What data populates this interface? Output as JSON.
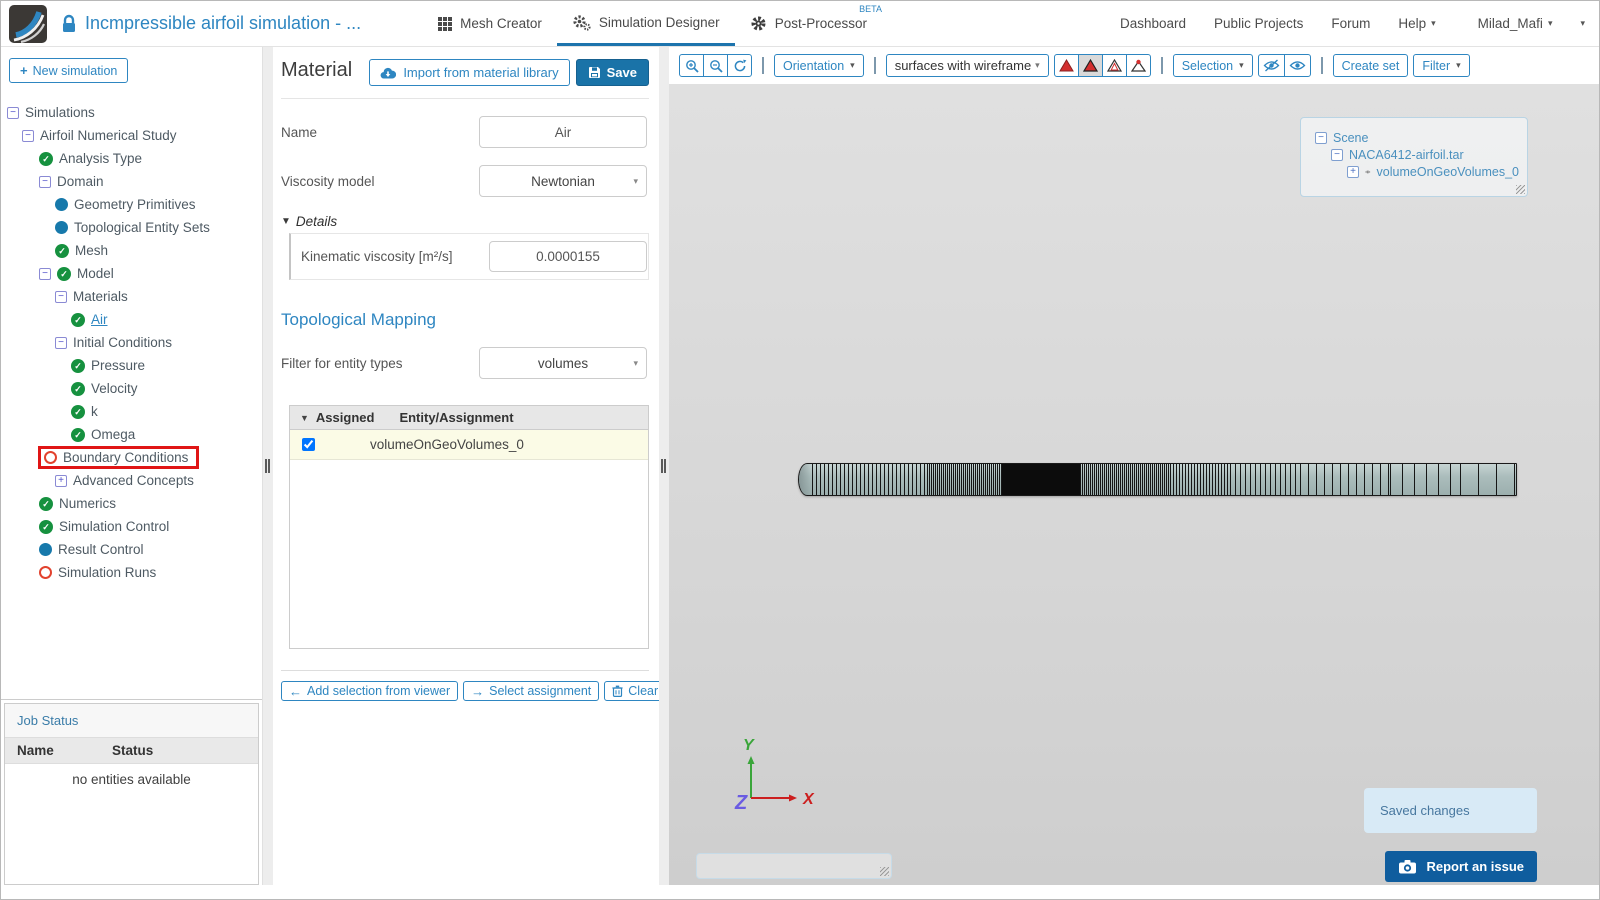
{
  "icons": {
    "caret": "▾",
    "sort_caret": "▼",
    "details_caret": "▼",
    "plus": "+",
    "minus": "−",
    "expand_plus": "+",
    "arrow_left": "←",
    "arrow_right": "→",
    "check": "✓"
  },
  "topbar": {
    "title": "Incmpressible airfoil simulation - ...",
    "tabs": [
      {
        "label": "Mesh Creator"
      },
      {
        "label": "Simulation Designer"
      },
      {
        "label": "Post-Processor",
        "badge": "BETA"
      }
    ],
    "links": {
      "dashboard": "Dashboard",
      "public_projects": "Public Projects",
      "forum": "Forum",
      "help": "Help"
    },
    "user": "Milad_Mafi"
  },
  "sidebar": {
    "new_simulation": "New simulation",
    "tree": [
      {
        "label": "Simulations"
      },
      {
        "label": "Airfoil Numerical Study"
      },
      {
        "label": "Analysis Type"
      },
      {
        "label": "Domain"
      },
      {
        "label": "Geometry Primitives"
      },
      {
        "label": "Topological Entity Sets"
      },
      {
        "label": "Mesh"
      },
      {
        "label": "Model"
      },
      {
        "label": "Materials"
      },
      {
        "label": "Air"
      },
      {
        "label": "Initial Conditions"
      },
      {
        "label": "Pressure"
      },
      {
        "label": "Velocity"
      },
      {
        "label": "k"
      },
      {
        "label": "Omega"
      },
      {
        "label": "Boundary Conditions"
      },
      {
        "label": "Advanced Concepts"
      },
      {
        "label": "Numerics"
      },
      {
        "label": "Simulation Control"
      },
      {
        "label": "Result Control"
      },
      {
        "label": "Simulation Runs"
      }
    ],
    "job_status": {
      "title": "Job Status",
      "name_header": "Name",
      "status_header": "Status",
      "empty_text": "no entities available"
    }
  },
  "material_panel": {
    "title": "Material",
    "import_button": "Import from material library",
    "save_button": "Save",
    "name_label": "Name",
    "name_value": "Air",
    "viscosity_label": "Viscosity model",
    "viscosity_value": "Newtonian",
    "details_label": "Details",
    "kinematic_viscosity_label": "Kinematic viscosity [m²/s]",
    "kinematic_viscosity_value": "0.0000155",
    "topological_mapping_title": "Topological Mapping",
    "filter_label": "Filter for entity types",
    "filter_value": "volumes",
    "table": {
      "assigned_header": "Assigned",
      "entity_header": "Entity/Assignment",
      "rows": [
        {
          "checked": true,
          "entity": "volumeOnGeoVolumes_0"
        }
      ]
    },
    "footer_buttons": {
      "add_selection": "Add selection from viewer",
      "select_assignment": "Select assignment",
      "clear": "Clear"
    }
  },
  "viewer": {
    "toolbar": {
      "orientation": "Orientation",
      "render_mode": "surfaces with wireframe",
      "selection": "Selection",
      "create_set": "Create set",
      "filter": "Filter"
    },
    "scene_tree": {
      "root": "Scene",
      "geometry": "NACA6412-airfoil.tar",
      "volume": "volumeOnGeoVolumes_0"
    },
    "axes": {
      "x": "X",
      "y": "Y",
      "z": "Z"
    },
    "toast": "Saved changes",
    "report_button": "Report an issue"
  },
  "colors": {
    "accent": "#2e86c1",
    "active_tab_underline": "#1d74ad",
    "save_button_bg": "#1a73a8",
    "report_button_bg": "#0f5d9e",
    "toast_bg": "#d8eaf6",
    "check_green": "#16913f",
    "entity_blue": "#1779ab",
    "incomplete_red": "#e2422e",
    "annotation_red": "#e01515",
    "assigned_row_bg": "#fbfbe6",
    "mesh_fill": "#abbdbc"
  }
}
